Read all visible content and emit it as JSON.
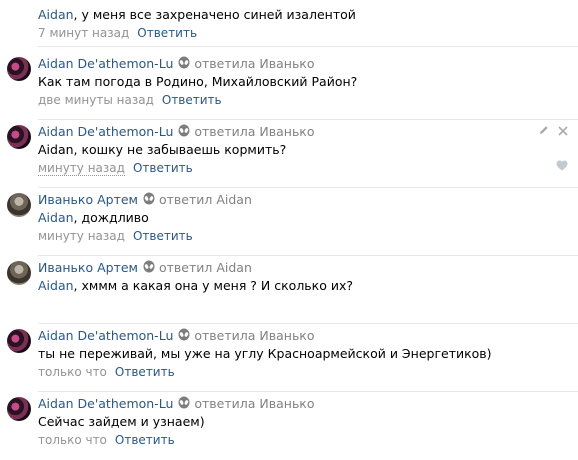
{
  "top_comment": {
    "mention": "Aidan",
    "text": ", у меня все захреначено синей изалентой",
    "time": "7 минут назад",
    "reply": "Ответить"
  },
  "comments": [
    {
      "author": "Aidan De'athemon-Lu",
      "replied": "ответила Иванько",
      "mention": "",
      "text": "Как там погода в Родино, Михайловский Район?",
      "time": "две минуты назад",
      "reply": "Ответить"
    },
    {
      "author": "Aidan De'athemon-Lu",
      "replied": "ответила Иванько",
      "mention": "",
      "text": "Aidan, кошку не забываешь кормить?",
      "time": "минуту назад",
      "reply": "Ответить"
    },
    {
      "author": "Иванько Артем",
      "replied": "ответил Aidan",
      "mention": "Aidan",
      "text": ", дождливо",
      "time": "минуту назад",
      "reply": "Ответить"
    },
    {
      "author": "Иванько Артем",
      "replied": "ответил Aidan",
      "mention": "Aidan",
      "text": ", хммм а какая она у меня ? И сколько их?",
      "time": "",
      "reply": ""
    },
    {
      "author": "Aidan De'athemon-Lu",
      "replied": "ответила Иванько",
      "mention": "",
      "text": "ты не переживай, мы уже на углу Красноармейской и Энергетиков)",
      "time": "только что",
      "reply": "Ответить"
    },
    {
      "author": "Aidan De'athemon-Lu",
      "replied": "ответила Иванько",
      "mention": "",
      "text": "Сейчас зайдем и узнаем)",
      "time": "только что",
      "reply": "Ответить"
    }
  ],
  "icons": {
    "alien": "alien-icon",
    "edit": "pencil-icon",
    "delete": "close-icon",
    "like": "heart-icon"
  },
  "colors": {
    "link": "#2a5885",
    "meta": "#939393",
    "separator": "#e7e8ec"
  }
}
